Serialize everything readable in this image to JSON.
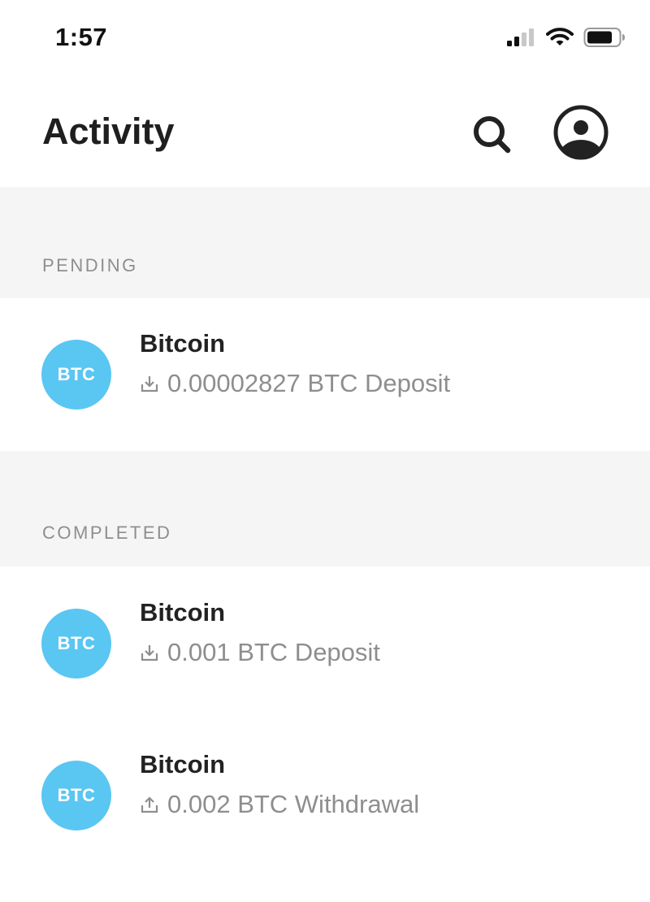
{
  "status_bar": {
    "time": "1:57",
    "icons": [
      "cellular-signal-icon",
      "wifi-icon",
      "battery-icon"
    ]
  },
  "header": {
    "title": "Activity",
    "icons": [
      "search-icon",
      "profile-icon"
    ]
  },
  "sections": {
    "pending": {
      "label": "PENDING",
      "items": [
        {
          "avatar_text": "BTC",
          "title": "Bitcoin",
          "detail": "0.00002827 BTC Deposit",
          "direction_icon": "download-icon"
        }
      ]
    },
    "completed": {
      "label": "COMPLETED",
      "items": [
        {
          "avatar_text": "BTC",
          "title": "Bitcoin",
          "detail": "0.001 BTC Deposit",
          "direction_icon": "download-icon"
        },
        {
          "avatar_text": "BTC",
          "title": "Bitcoin",
          "detail": "0.002 BTC Withdrawal",
          "direction_icon": "upload-icon"
        }
      ]
    }
  },
  "colors": {
    "avatar_bg": "#5ac6f2",
    "section_bg": "#f5f5f5",
    "muted_text": "#8e8e8e",
    "primary_text": "#1f1f1f"
  }
}
